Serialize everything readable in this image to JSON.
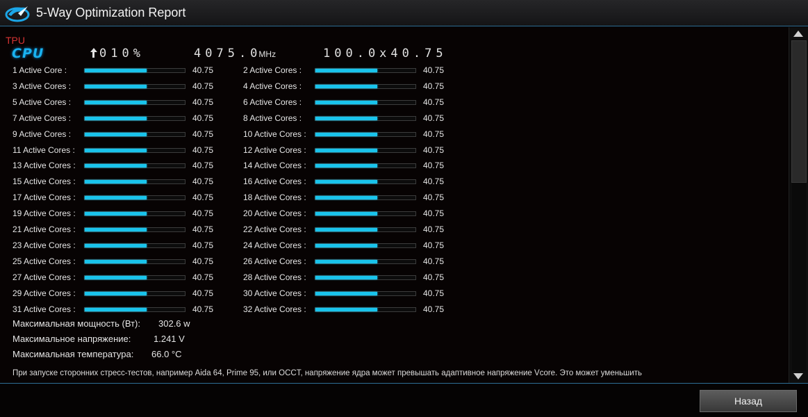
{
  "window": {
    "title": "5-Way Optimization Report"
  },
  "header": {
    "section": "TPU",
    "cpu_label": "CPU",
    "ratio": "010%",
    "frequency": "4075.0",
    "frequency_unit": "MHz",
    "multiplier": "100.0x40.75"
  },
  "cores": [
    {
      "label": "1 Active Core :",
      "value": "40.75",
      "level": 0.62
    },
    {
      "label": "2 Active Cores :",
      "value": "40.75",
      "level": 0.62
    },
    {
      "label": "3 Active Cores :",
      "value": "40.75",
      "level": 0.62
    },
    {
      "label": "4 Active Cores :",
      "value": "40.75",
      "level": 0.62
    },
    {
      "label": "5 Active Cores :",
      "value": "40.75",
      "level": 0.62
    },
    {
      "label": "6 Active Cores :",
      "value": "40.75",
      "level": 0.62
    },
    {
      "label": "7 Active Cores :",
      "value": "40.75",
      "level": 0.62
    },
    {
      "label": "8 Active Cores :",
      "value": "40.75",
      "level": 0.62
    },
    {
      "label": "9 Active Cores :",
      "value": "40.75",
      "level": 0.62
    },
    {
      "label": "10 Active Cores :",
      "value": "40.75",
      "level": 0.62
    },
    {
      "label": "11 Active Cores :",
      "value": "40.75",
      "level": 0.62
    },
    {
      "label": "12 Active Cores :",
      "value": "40.75",
      "level": 0.62
    },
    {
      "label": "13 Active Cores :",
      "value": "40.75",
      "level": 0.62
    },
    {
      "label": "14 Active Cores :",
      "value": "40.75",
      "level": 0.62
    },
    {
      "label": "15 Active Cores :",
      "value": "40.75",
      "level": 0.62
    },
    {
      "label": "16 Active Cores :",
      "value": "40.75",
      "level": 0.62
    },
    {
      "label": "17 Active Cores :",
      "value": "40.75",
      "level": 0.62
    },
    {
      "label": "18 Active Cores :",
      "value": "40.75",
      "level": 0.62
    },
    {
      "label": "19 Active Cores :",
      "value": "40.75",
      "level": 0.62
    },
    {
      "label": "20 Active Cores :",
      "value": "40.75",
      "level": 0.62
    },
    {
      "label": "21 Active Cores :",
      "value": "40.75",
      "level": 0.62
    },
    {
      "label": "22 Active Cores :",
      "value": "40.75",
      "level": 0.62
    },
    {
      "label": "23 Active Cores :",
      "value": "40.75",
      "level": 0.62
    },
    {
      "label": "24 Active Cores :",
      "value": "40.75",
      "level": 0.62
    },
    {
      "label": "25 Active Cores :",
      "value": "40.75",
      "level": 0.62
    },
    {
      "label": "26 Active Cores :",
      "value": "40.75",
      "level": 0.62
    },
    {
      "label": "27 Active Cores :",
      "value": "40.75",
      "level": 0.62
    },
    {
      "label": "28 Active Cores :",
      "value": "40.75",
      "level": 0.62
    },
    {
      "label": "29 Active Cores :",
      "value": "40.75",
      "level": 0.62
    },
    {
      "label": "30 Active Cores :",
      "value": "40.75",
      "level": 0.62
    },
    {
      "label": "31 Active Cores :",
      "value": "40.75",
      "level": 0.62
    },
    {
      "label": "32 Active Cores :",
      "value": "40.75",
      "level": 0.62
    }
  ],
  "summary": {
    "max_power_label": "Максимальная мощность (Вт):",
    "max_power_value": "302.6 w",
    "max_voltage_label": "Максимальное напряжение:",
    "max_voltage_value": "1.241 V",
    "max_temp_label": "Максимальная температура:",
    "max_temp_value": "66.0 °C"
  },
  "note": "При запуске сторонних стресс-тестов, например Aida 64, Prime 95, или OCCT, напряжение ядра может превышать адаптивное напряжение Vcore. Это может уменьшить",
  "footer": {
    "back_label": "Назад"
  },
  "colors": {
    "accent": "#19c4ec",
    "section_label": "#d83434",
    "border": "#2e6f96"
  }
}
